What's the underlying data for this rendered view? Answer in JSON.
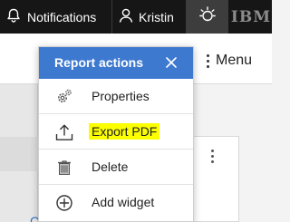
{
  "topbar": {
    "notifications_label": "Notifications",
    "user_name": "Kristin",
    "brand": "IBM"
  },
  "page": {
    "menu_label": "Menu",
    "bottom_link_text": "Cu"
  },
  "dropdown": {
    "title": "Report actions",
    "items": [
      {
        "label": "Properties",
        "icon": "gear-icon",
        "highlighted": false
      },
      {
        "label": "Export PDF",
        "icon": "upload-icon",
        "highlighted": true
      },
      {
        "label": "Delete",
        "icon": "trash-icon",
        "highlighted": false
      },
      {
        "label": "Add widget",
        "icon": "add-circle-icon",
        "highlighted": false
      }
    ]
  },
  "colors": {
    "topbar_bg": "#161616",
    "dropdown_header": "#3e79d0",
    "highlight": "#fbff00"
  }
}
